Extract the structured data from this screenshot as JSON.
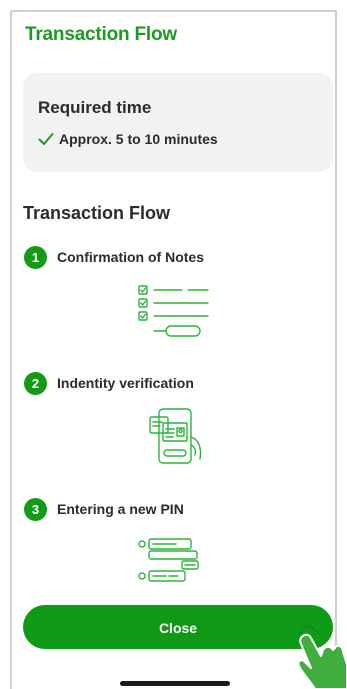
{
  "header": {
    "title": "Transaction Flow"
  },
  "time_card": {
    "title": "Required time",
    "detail": "Approx. 5 to 10 minutes"
  },
  "flow": {
    "title": "Transaction Flow",
    "steps": [
      {
        "number": "1",
        "label": "Confirmation of Notes",
        "icon": "checklist-icon"
      },
      {
        "number": "2",
        "label": "Indentity verification",
        "icon": "id-card-phone-icon"
      },
      {
        "number": "3",
        "label": "Entering a new PIN",
        "icon": "pin-entry-icon"
      }
    ]
  },
  "footer": {
    "close_label": "Close"
  },
  "colors": {
    "brand_green": "#1e9a22",
    "button_green": "#0f9a17",
    "card_background": "#f2f2f2",
    "text_dark": "#2b2b2b"
  }
}
